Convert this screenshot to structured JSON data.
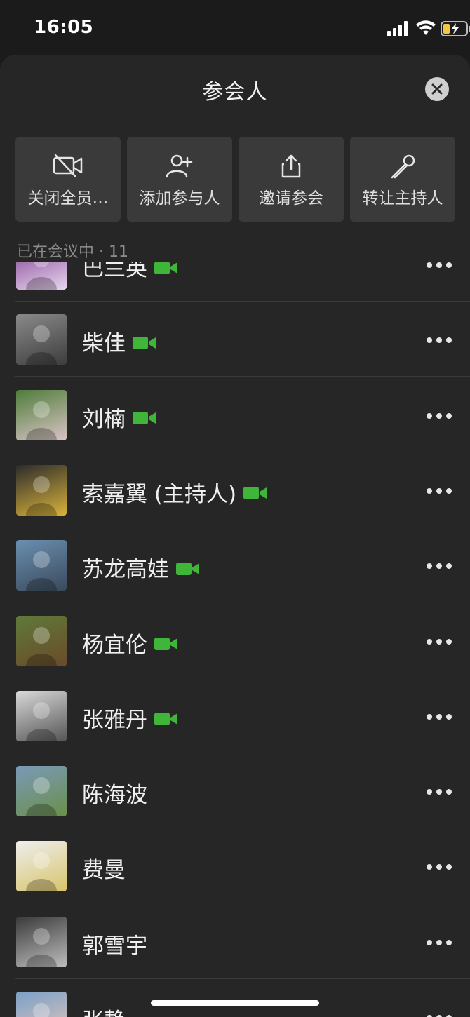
{
  "status": {
    "time": "16:05"
  },
  "sheet": {
    "title": "参会人"
  },
  "actions": [
    {
      "label": "关闭全员…",
      "icon": "camera-off-icon"
    },
    {
      "label": "添加参与人",
      "icon": "add-person-icon"
    },
    {
      "label": "邀请参会",
      "icon": "share-icon"
    },
    {
      "label": "转让主持人",
      "icon": "microphone-icon"
    }
  ],
  "section": {
    "label": "已在会议中 · 11"
  },
  "participants": [
    {
      "name": "巴兰英",
      "video": true
    },
    {
      "name": "柴佳",
      "video": true
    },
    {
      "name": "刘楠",
      "video": true
    },
    {
      "name": "索嘉翼 (主持人)",
      "video": true
    },
    {
      "name": "苏龙高娃",
      "video": true
    },
    {
      "name": "杨宜伦",
      "video": true
    },
    {
      "name": "张雅丹",
      "video": true
    },
    {
      "name": "陈海波",
      "video": false
    },
    {
      "name": "费曼",
      "video": false
    },
    {
      "name": "郭雪宇",
      "video": false
    },
    {
      "name": "张静",
      "video": false
    }
  ],
  "colors": {
    "accent": "#3fb53a",
    "background": "#262626",
    "button": "#3a3a3a"
  }
}
